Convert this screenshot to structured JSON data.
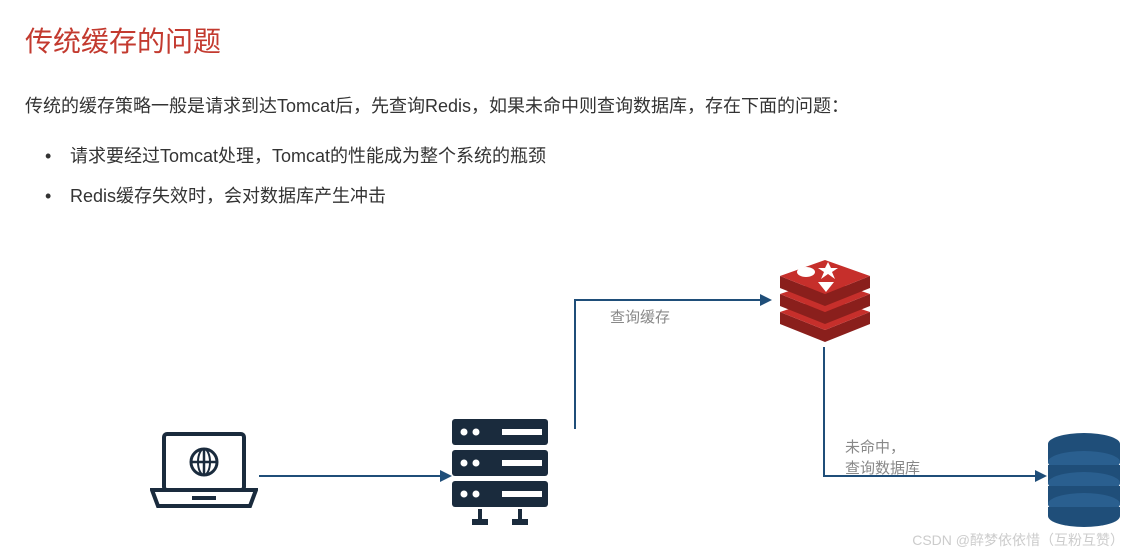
{
  "title": "传统缓存的问题",
  "description": "传统的缓存策略一般是请求到达Tomcat后，先查询Redis，如果未命中则查询数据库，存在下面的问题：",
  "bullets": [
    "请求要经过Tomcat处理，Tomcat的性能成为整个系统的瓶颈",
    "Redis缓存失效时，会对数据库产生冲击"
  ],
  "diagram": {
    "label_cache": "查询缓存",
    "label_miss_line1": "未命中，",
    "label_miss_line2": "查询数据库"
  },
  "watermark": "CSDN @醉梦依依惜（互粉互赞）",
  "colors": {
    "title": "#c33a2f",
    "arrow": "#1f4e79",
    "redis": "#c62f2b",
    "server": "#1a2b3d",
    "database": "#1f4e79"
  }
}
